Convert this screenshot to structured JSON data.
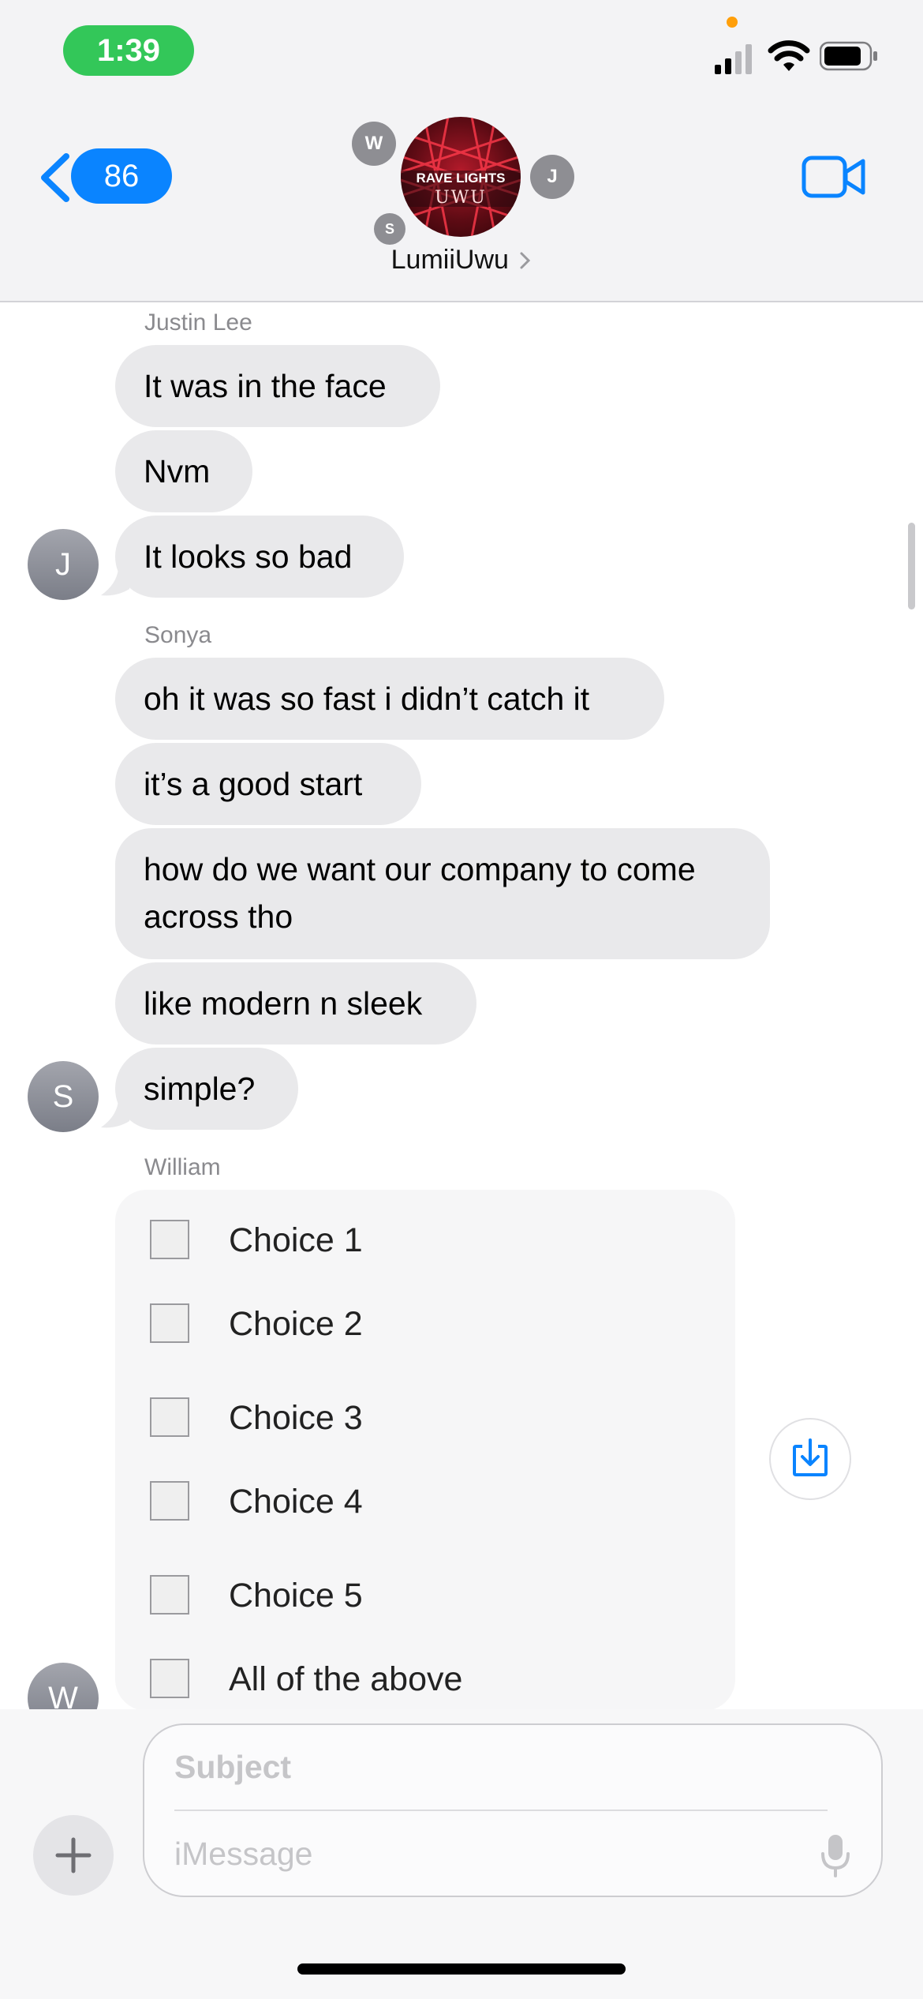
{
  "status_bar": {
    "time": "1:39",
    "icons": [
      "cellular-signal-icon",
      "wifi-icon",
      "battery-icon"
    ]
  },
  "header": {
    "back_count": "86",
    "group_name": "LumiiUwu",
    "group_avatar_text_line1": "RAVE LIGHTS",
    "group_avatar_text_line2": "UWU",
    "member_initials": [
      "W",
      "J",
      "S"
    ]
  },
  "messages": {
    "justin": {
      "sender": "Justin Lee",
      "avatar": "J",
      "texts": [
        "It was in the face",
        "Nvm",
        "It looks so bad"
      ]
    },
    "sonya": {
      "sender": "Sonya",
      "avatar": "S",
      "texts": [
        "oh it was so fast i didn’t catch it",
        "it’s a good start",
        "how do we want our company to come across tho",
        "like modern n sleek",
        "simple?"
      ]
    },
    "william": {
      "sender": "William",
      "avatar": "W"
    }
  },
  "poll": {
    "choices": [
      "Choice 1",
      "Choice 2",
      "Choice 3",
      "Choice 4",
      "Choice 5",
      "All of the above"
    ]
  },
  "compose": {
    "subject_placeholder": "Subject",
    "message_placeholder": "iMessage"
  },
  "colors": {
    "accent": "#0a84ff",
    "bubble_gray": "#e9e9eb",
    "status_green": "#33c759"
  }
}
